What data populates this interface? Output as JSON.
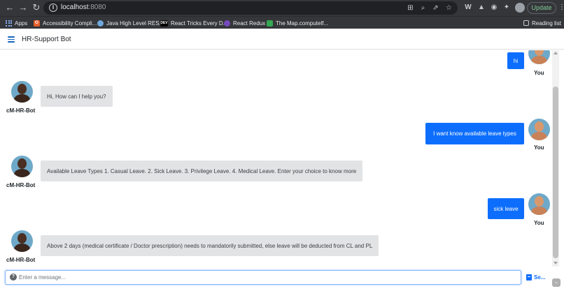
{
  "browser": {
    "url_host": "localhost",
    "url_port": ":8080",
    "update_label": "Update",
    "bookmarks": [
      {
        "label": "Apps",
        "icon": "apps-grid-icon",
        "color": "#8ab4f8"
      },
      {
        "label": "Accessibility Compli...",
        "icon": "accessibility-favicon",
        "color": "#e8602c"
      },
      {
        "label": "Java High Level RES...",
        "icon": "globe-favicon",
        "color": "#6fa8dc"
      },
      {
        "label": "React Tricks Every D...",
        "icon": "dev-favicon",
        "color": "#000000"
      },
      {
        "label": "React Redux",
        "icon": "redux-favicon",
        "color": "#764abc"
      },
      {
        "label": "The Map.computelf...",
        "icon": "map-favicon",
        "color": "#34a853"
      }
    ],
    "reading_list_label": "Reading list"
  },
  "app": {
    "title": "HR-Support Bot",
    "menu_icon": "hamburger-menu-icon",
    "accent_color": "#0d6efd"
  },
  "messages": [
    {
      "sender": "user",
      "name": "You",
      "text": "hi"
    },
    {
      "sender": "bot",
      "name": "cM-HR-Bot",
      "text": "Hi, How can I help you?"
    },
    {
      "sender": "user",
      "name": "You",
      "text": "I want know available leave types"
    },
    {
      "sender": "bot",
      "name": "cM-HR-Bot",
      "text": "Available Leave Types 1. Casual Leave. 2. Sick Leave. 3. Privilege Leave. 4. Medical Leave. Enter your choice to know more"
    },
    {
      "sender": "user",
      "name": "You",
      "text": "sick leave"
    },
    {
      "sender": "bot",
      "name": "cM-HR-Bot",
      "text": "Above 2 days (medical certificate / Doctor prescription) needs to mandatorily submitted, else leave will be deducted from CL and PL"
    }
  ],
  "composer": {
    "placeholder": "Enter a message...",
    "value": "",
    "send_label": "Se..."
  }
}
